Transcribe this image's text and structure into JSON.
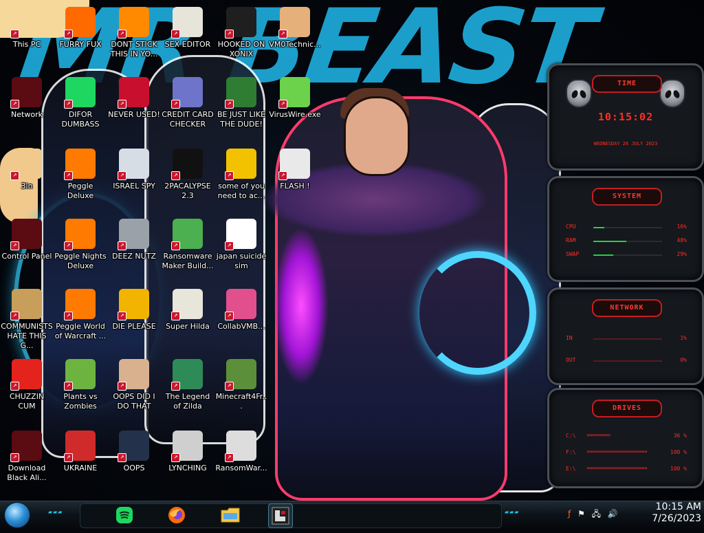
{
  "wallpaper": {
    "title": "MR BEAST"
  },
  "desktop_icons": [
    {
      "label": "This PC",
      "icon": "this-pc-icon",
      "color": "#f5d89a"
    },
    {
      "label": "FURRY FUX",
      "icon": "firefox-icon",
      "color": "#ff6a00"
    },
    {
      "label": "DONT STICK THIS IN YO...",
      "icon": "vlc-cone-icon",
      "color": "#ff8a00"
    },
    {
      "label": "SEX EDITOR",
      "icon": "hex-editor-icon",
      "color": "#e7e4da"
    },
    {
      "label": "HOOKED ON XONIX",
      "icon": "xonix-game-icon",
      "color": "#1f1f1f"
    },
    {
      "label": "VM0Technic...",
      "icon": "doctor-icon",
      "color": "#e6b07a"
    },
    {
      "label": "Network",
      "icon": "alien-head-icon",
      "color": "#5a0c12"
    },
    {
      "label": "DIFOR DUMBASS",
      "icon": "spotify-icon",
      "color": "#1ed760"
    },
    {
      "label": "NEVER USED!",
      "icon": "dev-cpp-icon",
      "color": "#c8102e"
    },
    {
      "label": "CREDIT CARD CHECKER",
      "icon": "credit-card-icon",
      "color": "#6e74c9"
    },
    {
      "label": "BE JUST LIKE THE DUDE!",
      "icon": "santa-elf-icon",
      "color": "#2e7d32"
    },
    {
      "label": "VirusWire.exe",
      "icon": "lime-icon",
      "color": "#6cd14b"
    },
    {
      "label": "3in",
      "icon": "star-char-icon",
      "color": "#f2c98d"
    },
    {
      "label": "Peggle Deluxe",
      "icon": "peggle-icon",
      "color": "#ff7a00"
    },
    {
      "label": "ISRAEL SPY",
      "icon": "network-adapter-icon",
      "color": "#d7dde5"
    },
    {
      "label": "2PACALYPSE 2.3",
      "icon": "cmd-prompt-icon",
      "color": "#111111"
    },
    {
      "label": "some of you need to ac...",
      "icon": "dog-icon",
      "color": "#f2c200"
    },
    {
      "label": "FLASH !",
      "icon": "flash-installer-icon",
      "color": "#e9e9e9"
    },
    {
      "label": "Control Panel",
      "icon": "control-panel-icon",
      "color": "#5a0c12"
    },
    {
      "label": "Peggle Nights Deluxe",
      "icon": "peggle-nights-icon",
      "color": "#ff7a00"
    },
    {
      "label": "DEEZ NUTZ",
      "icon": "windows-stack-icon",
      "color": "#9aa1a8"
    },
    {
      "label": "Ransomware Maker Build...",
      "icon": "app-window-icon",
      "color": "#4caf50"
    },
    {
      "label": "japan suicide sim",
      "icon": "download-file-icon",
      "color": "#ffffff"
    },
    {
      "label": "COMMUNISTS HATE THIS G...",
      "icon": "money-bag-icon",
      "color": "#c89f5a"
    },
    {
      "label": "Peggle World of Warcraft ...",
      "icon": "peggle-wow-icon",
      "color": "#ff7a00"
    },
    {
      "label": "DIE PLEASE",
      "icon": "director-icon",
      "color": "#f2b400"
    },
    {
      "label": "Super Hilda",
      "icon": "pixel-cat-icon",
      "color": "#e8e6da"
    },
    {
      "label": "CollabVMB...",
      "icon": "display-icon",
      "color": "#e24f8d"
    },
    {
      "label": "CHUZZIN CUM",
      "icon": "chuzzle-icon",
      "color": "#e5231d"
    },
    {
      "label": "Plants vs Zombies",
      "icon": "pvz-icon",
      "color": "#6db33f"
    },
    {
      "label": "OOPS DID I DO THAT",
      "icon": "portrait-icon",
      "color": "#d9b18f"
    },
    {
      "label": "The Legend of Zilda",
      "icon": "zelda-sprite-icon",
      "color": "#2e8b57"
    },
    {
      "label": "Minecraft4Fr...",
      "icon": "minecraft-block-icon",
      "color": "#5b8f3a"
    },
    {
      "label": "Download Black Ali...",
      "icon": "alien-head-icon",
      "color": "#5a0c12"
    },
    {
      "label": "UKRAINE",
      "icon": "radiation-icon",
      "color": "#d12a2a"
    },
    {
      "label": "OOPS",
      "icon": "trash-window-icon",
      "color": "#23324a"
    },
    {
      "label": "LYNCHING",
      "icon": "rope-icon",
      "color": "#cfcfcf"
    },
    {
      "label": "RansomWar...",
      "icon": "skull-icon",
      "color": "#dddddd"
    }
  ],
  "widgets": {
    "clock": {
      "title": "TIME",
      "time": "10:15:02",
      "date": "WEDNESDAY 26 JULY 2023"
    },
    "system": {
      "title": "SYSTEM",
      "rows": [
        {
          "label": "CPU",
          "value": "16%",
          "fill": 0.16
        },
        {
          "label": "RAM",
          "value": "48%",
          "fill": 0.48
        },
        {
          "label": "SWAP",
          "value": "29%",
          "fill": 0.29
        }
      ]
    },
    "network": {
      "title": "NETWORK",
      "rows": [
        {
          "label": "IN",
          "value": "1%"
        },
        {
          "label": "OUT",
          "value": "0%"
        }
      ]
    },
    "drives": {
      "title": "DRIVES",
      "rows": [
        {
          "label": "C:\\",
          "value": "36 %"
        },
        {
          "label": "F:\\",
          "value": "100 %"
        },
        {
          "label": "E:\\",
          "value": "100 %"
        }
      ]
    }
  },
  "taskbar": {
    "pinned": [
      {
        "name": "spotify",
        "icon": "spotify-icon",
        "color": "#1ed760"
      },
      {
        "name": "firefox",
        "icon": "firefox-icon",
        "color": "#ff6a00"
      },
      {
        "name": "file-explorer",
        "icon": "folder-icon",
        "color": "#f2c94c"
      },
      {
        "name": "xonix",
        "icon": "xonix-game-icon",
        "color": "#1f1f1f"
      }
    ],
    "tray_icons": [
      "flash-tray-icon",
      "flag-icon",
      "network-icon",
      "volume-icon"
    ],
    "time": "10:15 AM",
    "date": "7/26/2023"
  }
}
